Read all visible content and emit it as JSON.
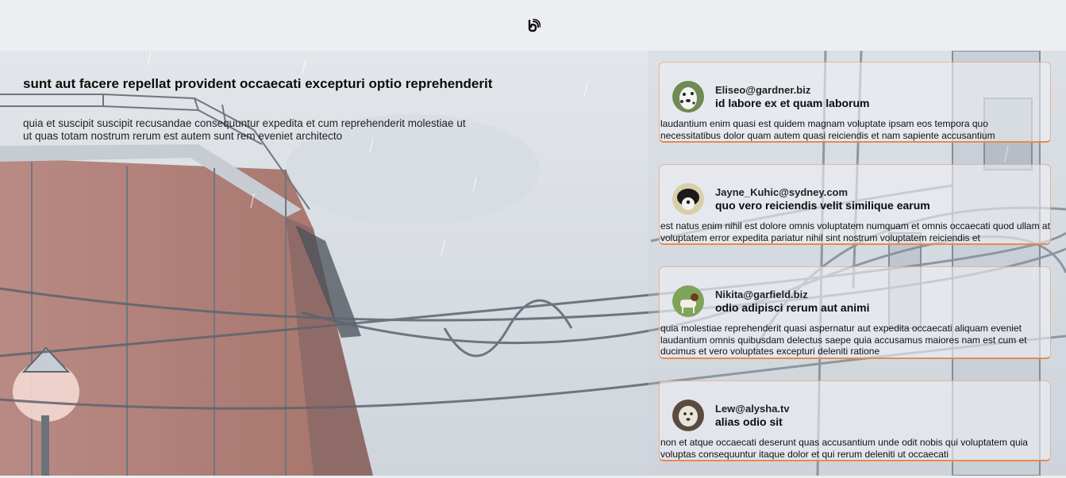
{
  "header": {
    "logo_icon": "swirl-logo-icon"
  },
  "post": {
    "title": "sunt aut facere repellat provident occaecati excepturi optio reprehenderit",
    "body": "quia et suscipit suscipit recusandae consequuntur expedita et cum reprehenderit molestiae ut ut quas totam nostrum rerum est autem sunt rem eveniet architecto"
  },
  "comments": [
    {
      "email": "Eliseo@gardner.biz",
      "name": "id labore ex et quam laborum",
      "body": "laudantium enim quasi est quidem magnam voluptate ipsam eos tempora quo necessitatibus dolor quam autem quasi reiciendis et nam sapiente accusantium",
      "avatar": "dalmatian-avatar"
    },
    {
      "email": "Jayne_Kuhic@sydney.com",
      "name": "quo vero reiciendis velit similique earum",
      "body": "est natus enim nihil est dolore omnis voluptatem numquam et omnis occaecati quod ullam at voluptatem error expedita pariatur nihil sint nostrum voluptatem reiciendis et",
      "avatar": "black-white-dog-avatar"
    },
    {
      "email": "Nikita@garfield.biz",
      "name": "odio adipisci rerum aut animi",
      "body": "quia molestiae reprehenderit quasi aspernatur aut expedita occaecati aliquam eveniet laudantium omnis quibusdam delectus saepe quia accusamus maiores nam est cum et ducimus et vero voluptates excepturi deleniti ratione",
      "avatar": "terrier-avatar"
    },
    {
      "email": "Lew@alysha.tv",
      "name": "alias odio sit",
      "body": "non et atque occaecati deserunt quas accusantium unde odit nobis qui voluptatem quia voluptas consequuntur itaque dolor et qui rerum deleniti ut occaecati",
      "avatar": "white-dog-avatar"
    }
  ],
  "colors": {
    "accent": "#e98a4a",
    "topbar": "#eceef2"
  }
}
